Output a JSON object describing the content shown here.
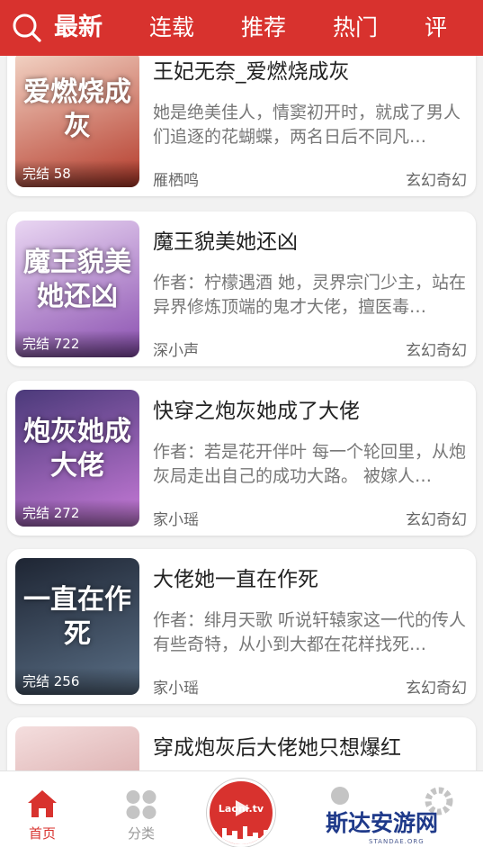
{
  "header": {
    "tabs": [
      {
        "label": "最新",
        "active": true
      },
      {
        "label": "连载"
      },
      {
        "label": "推荐"
      },
      {
        "label": "热门"
      },
      {
        "label": "评"
      }
    ]
  },
  "books": [
    {
      "title": "王妃无奈_爱燃烧成灰",
      "desc": "她是绝美佳人，情窦初开时，就成了男人们追逐的花蝴蝶，两名日后不同凡…",
      "author": "雁栖鸣",
      "genre": "玄幻奇幻",
      "badge": "完结 58",
      "cover_text": "爱燃烧成灰",
      "cover_colors": [
        "#f3d5c6",
        "#b43a2a"
      ]
    },
    {
      "title": "魔王貌美她还凶",
      "desc": "作者：柠檬遇酒 她，灵界宗门少主，站在异界修炼顶端的鬼才大佬，擅医毒…",
      "author": "深小声",
      "genre": "玄幻奇幻",
      "badge": "完结 722",
      "cover_text": "魔王貌美她还凶",
      "cover_colors": [
        "#e9d6f2",
        "#8a4fb0"
      ]
    },
    {
      "title": "快穿之炮灰她成了大佬",
      "desc": "作者：若是花开伴叶 每一个轮回里，从炮灰局走出自己的成功大路。 被嫁人…",
      "author": "家小瑶",
      "genre": "玄幻奇幻",
      "badge": "完结 272",
      "cover_text": "炮灰她成大佬",
      "cover_colors": [
        "#4b3a7a",
        "#c77ad8"
      ]
    },
    {
      "title": "大佬她一直在作死",
      "desc": "作者：绯月天歌 听说轩辕家这一代的传人有些奇特，从小到大都在花样找死…",
      "author": "家小瑶",
      "genre": "玄幻奇幻",
      "badge": "完结 256",
      "cover_text": "一直在作死",
      "cover_colors": [
        "#1e2533",
        "#5a6f86"
      ]
    },
    {
      "title": "穿成炮灰后大佬她只想爆红",
      "desc": "",
      "author": "",
      "genre": "",
      "badge": "",
      "cover_text": "",
      "cover_colors": [
        "#f4dede",
        "#c98a8a"
      ]
    }
  ],
  "bottom_nav": {
    "home_label": "首页",
    "category_label": "分类",
    "center_text": "Laoni.tv",
    "watermark": "斯达安游网",
    "watermark_sub": "STANDAE.ORG"
  }
}
